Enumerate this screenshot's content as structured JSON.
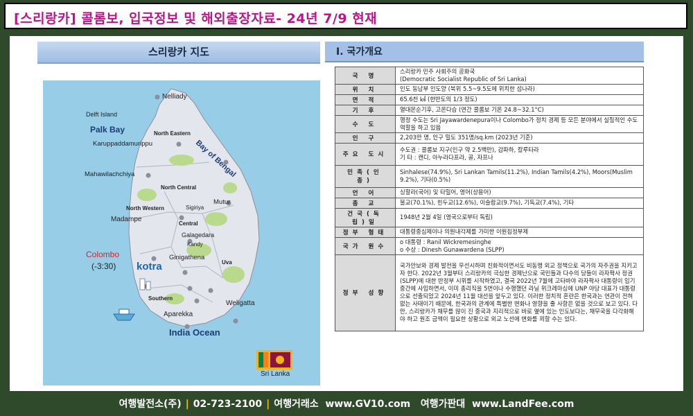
{
  "title": "[스리랑카] 콜롬보, 입국정보 및 해외출장자료- 24년 7/9 현재",
  "map": {
    "header": "스리랑카 지도",
    "places": {
      "nelliady": "Nelliady",
      "delft": "Delft Island",
      "palk_bay": "Palk Bay",
      "karuppaddamurippu": "Karuppaddamurippu",
      "north_eastern": "North Eastern",
      "bay_of_bengal": "Bay of Bengal",
      "mahawilachchiya": "Mahawilachchiya",
      "mutur": "Mutur",
      "north_central": "North Central",
      "north_western": "North Western",
      "sigiriya": "Sigiriya",
      "madampe": "Madampe",
      "central": "Central",
      "galagedara": "Galagedara",
      "kandy": "Kandy",
      "colombo": "Colombo",
      "colombo_tz": "(-3:30)",
      "ginigathena": "Ginigathena",
      "uva": "Uva",
      "kotra": "kotra",
      "southern": "Southern",
      "weligatta": "Weligatta",
      "aparekka": "Aparekka",
      "india_ocean": "India Ocean",
      "sri_lanka": "Sri Lanka"
    }
  },
  "info": {
    "header": "Ⅰ. 국가개요",
    "rows": [
      {
        "key": "국 명",
        "value": [
          "스리랑카 민주 사회주의 공화국",
          "(Democratic Socialist Republic of Sri Lanka)"
        ]
      },
      {
        "key": "위 치",
        "value": [
          "인도 동남부 인도양 (북위 5.5~9.5도에 위치한 섬나라)"
        ]
      },
      {
        "key": "면 적",
        "value": [
          "65.6천 ㎢ (한반도의 1/3 정도)"
        ]
      },
      {
        "key": "기 후",
        "value": [
          "열대몬순기후, 고온다습 (연간 콜롬보 기온 24.8~32.1°C)"
        ]
      },
      {
        "key": "수 도",
        "value": [
          "행정 수도는 Sri Jayawardenepura이나 Colombo가 정치 경제 등 모든 분야에서 실질적인 수도역할을 하고 있음"
        ]
      },
      {
        "key": "인 구",
        "value": [
          "2,203만 명, 인구 밀도 351명/sq.km (2023년 기준)"
        ]
      },
      {
        "key": "주요 도시",
        "value": [
          "수도권 : 콜롬보 지구(인구 약 2.5백만), 감파하, 칼루타라",
          "기 타 : 캔디, 아누라다프라, 골, 자프나"
        ]
      },
      {
        "key": "민족(인종)",
        "value": [
          "Sinhalese(74.9%), Sri Lankan Tamils(11.2%), Indian Tamils(4.2%), Moors(Muslim 9.2%), 기타(0.5%)"
        ]
      },
      {
        "key": "언 어",
        "value": [
          "싱할라(국어) 및 타밀어, 영어(상용어)"
        ]
      },
      {
        "key": "종 교",
        "value": [
          "불교(70.1%), 힌두교(12.6%), 이슬람교(9.7%), 기독교(7.4%), 기타"
        ]
      },
      {
        "key": "건국(독립)일",
        "value": [
          "1948년 2월 4일 (영국으로부터 독립)"
        ]
      },
      {
        "key": "정부 형태",
        "value": [
          "대통령중심제이나 의원내각제를 가미한 이원집정부제"
        ]
      },
      {
        "key": "국가 원수",
        "value": [
          "o 대통령 : Ranil Wickremesinghe",
          "o 수상 : Dinesh Gunawardena (SLPP)"
        ]
      },
      {
        "key": "정부 성향",
        "value": [
          "국가안보와 경제 발전을 우선시하며 친화적이면서도 비동맹 외교 정책으로 국가의 자주권을 지키고자 한다. 2022년 3월부터 스리랑카의 극심한 경제난으로 국민들과 다수의 당들이 라자팍사 정권(SLPP)에 대한 반정부 시위를 시작하였고, 결국 2022년 7월에 고타바야 라자팍사 대통령이 임기 중간에 사임하면서, 이미 총리직을 5번이나 수행했던 라닐 위크레마싱에 UNP 야당 대표가 대통령으로 선출되었고 2024년 11월 대선을 앞두고 있다. 이러한 정치적 혼란은 한국과는 연관이 전혀 없는 사태이기 때문에, 한국과의 관계에 특별한 변화나 영향을 줄 사항은 없을 것으로 보고 있다. 다만, 스리랑카가 채무를 많이 진 중국과 지리적으로 바로 옆에 있는 인도보다는, 채무국을 다각화해야 하고 원조 금액이 필요한 상황으로 외교 노선에 변화를 꾀할 수는 있다."
        ]
      }
    ]
  },
  "footer": {
    "company": "여행발전소(주)",
    "phone": "02-723-2100",
    "agency": "여행거래소",
    "agency_url": "www.GV10.com",
    "market": "여행가판대",
    "market_url": "www.LandFee.com"
  },
  "colors": {
    "title": "#b8168a",
    "background": "#2f4a2a",
    "sea": "#98cde8",
    "land": "#e3e6ec",
    "colombo": "#d8232a",
    "kotra": "#1e63b0",
    "footer_sep": "#f2c200"
  }
}
